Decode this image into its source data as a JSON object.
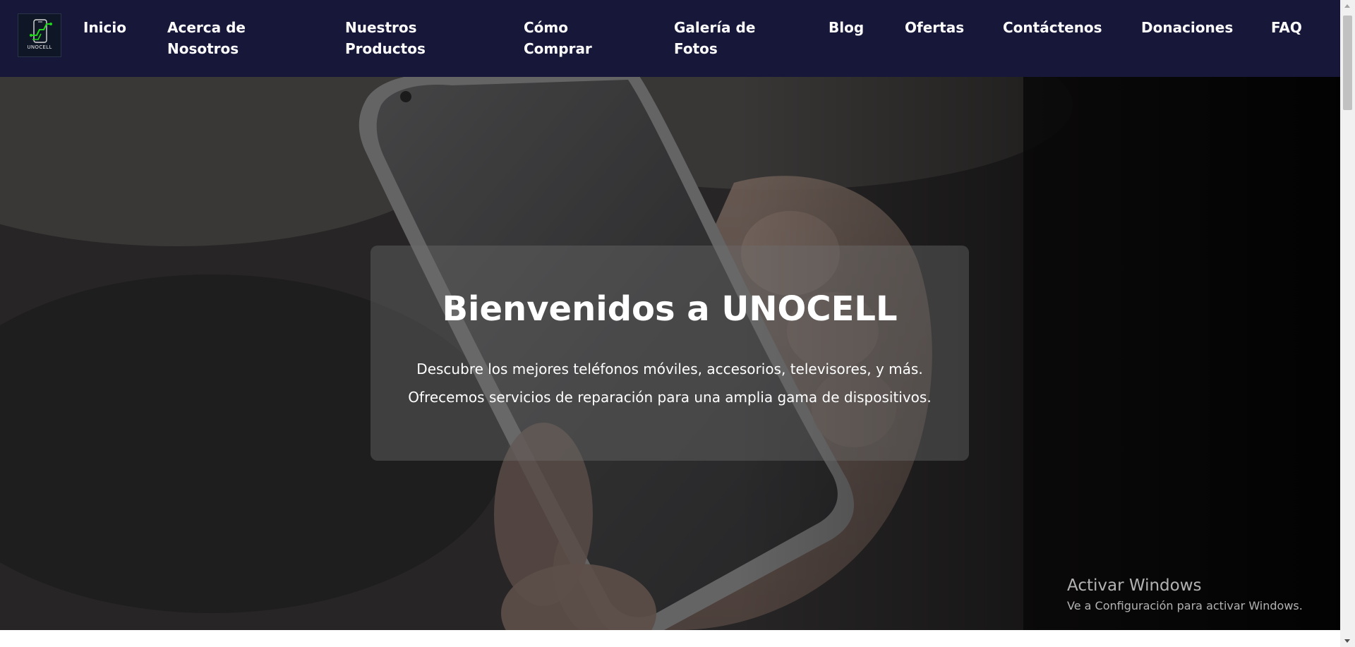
{
  "brand": {
    "logo_text": "UNOCELL",
    "logo_accent_color": "#22d31c"
  },
  "nav": {
    "items": [
      {
        "label": "Inicio"
      },
      {
        "label": "Acerca de Nosotros"
      },
      {
        "label": "Nuestros Productos"
      },
      {
        "label": "Cómo Comprar"
      },
      {
        "label": "Galería de Fotos"
      },
      {
        "label": "Blog"
      },
      {
        "label": "Ofertas"
      },
      {
        "label": "Contáctenos"
      },
      {
        "label": "Donaciones"
      },
      {
        "label": "FAQ"
      }
    ],
    "background_color": "#17173a"
  },
  "hero": {
    "title": "Bienvenidos a UNOCELL",
    "line1": "Descubre los mejores teléfonos móviles, accesorios, televisores, y más.",
    "line2": "Ofrecemos servicios de reparación para una amplia gama de dispositivos."
  },
  "watermark": {
    "title": "Activar Windows",
    "subtitle": "Ve a Configuración para activar Windows."
  }
}
